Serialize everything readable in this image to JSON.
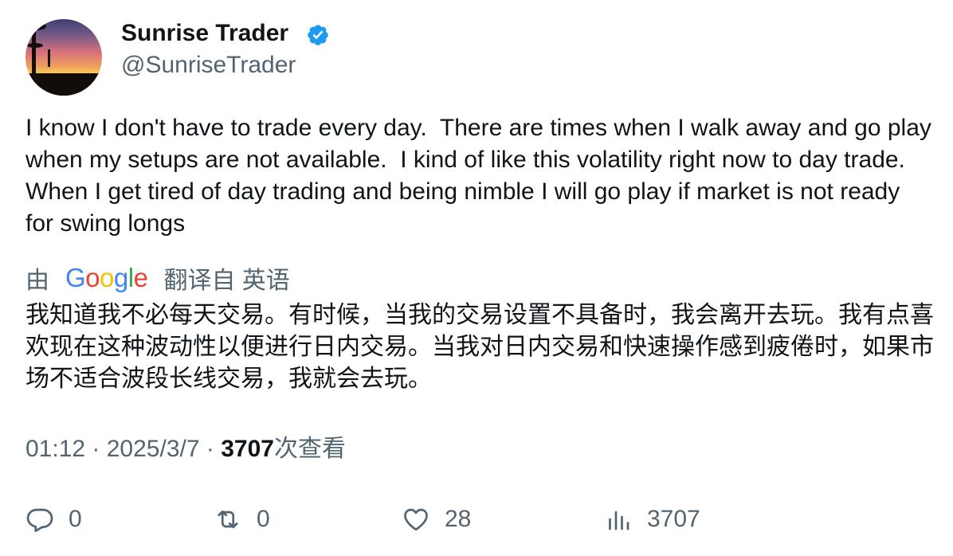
{
  "author": {
    "display_name": "Sunrise Trader",
    "handle": "@SunriseTrader",
    "verified": true
  },
  "tweet": {
    "text": "I know I don't have to trade every day.  There are times when I walk away and go play when my setups are not available.  I kind of like this volatility right now to day trade.  When I get tired of day trading and being nimble I will go play if market is not ready for swing longs",
    "translation": {
      "prefix": "由",
      "provider": "Google",
      "suffix": "翻译自 英语",
      "text": "我知道我不必每天交易。有时候，当我的交易设置不具备时，我会离开去玩。我有点喜欢现在这种波动性以便进行日内交易。当我对日内交易和快速操作感到疲倦时，如果市场不适合波段长线交易，我就会去玩。"
    },
    "time": "01:12",
    "separator": "·",
    "date": "2025/3/7",
    "views": "3707",
    "views_label": "次查看"
  },
  "actions": {
    "replies": "0",
    "retweets": "0",
    "likes": "28",
    "views": "3707"
  },
  "colors": {
    "verified": "#1d9bf0",
    "muted": "#536471",
    "text": "#0f1419"
  }
}
